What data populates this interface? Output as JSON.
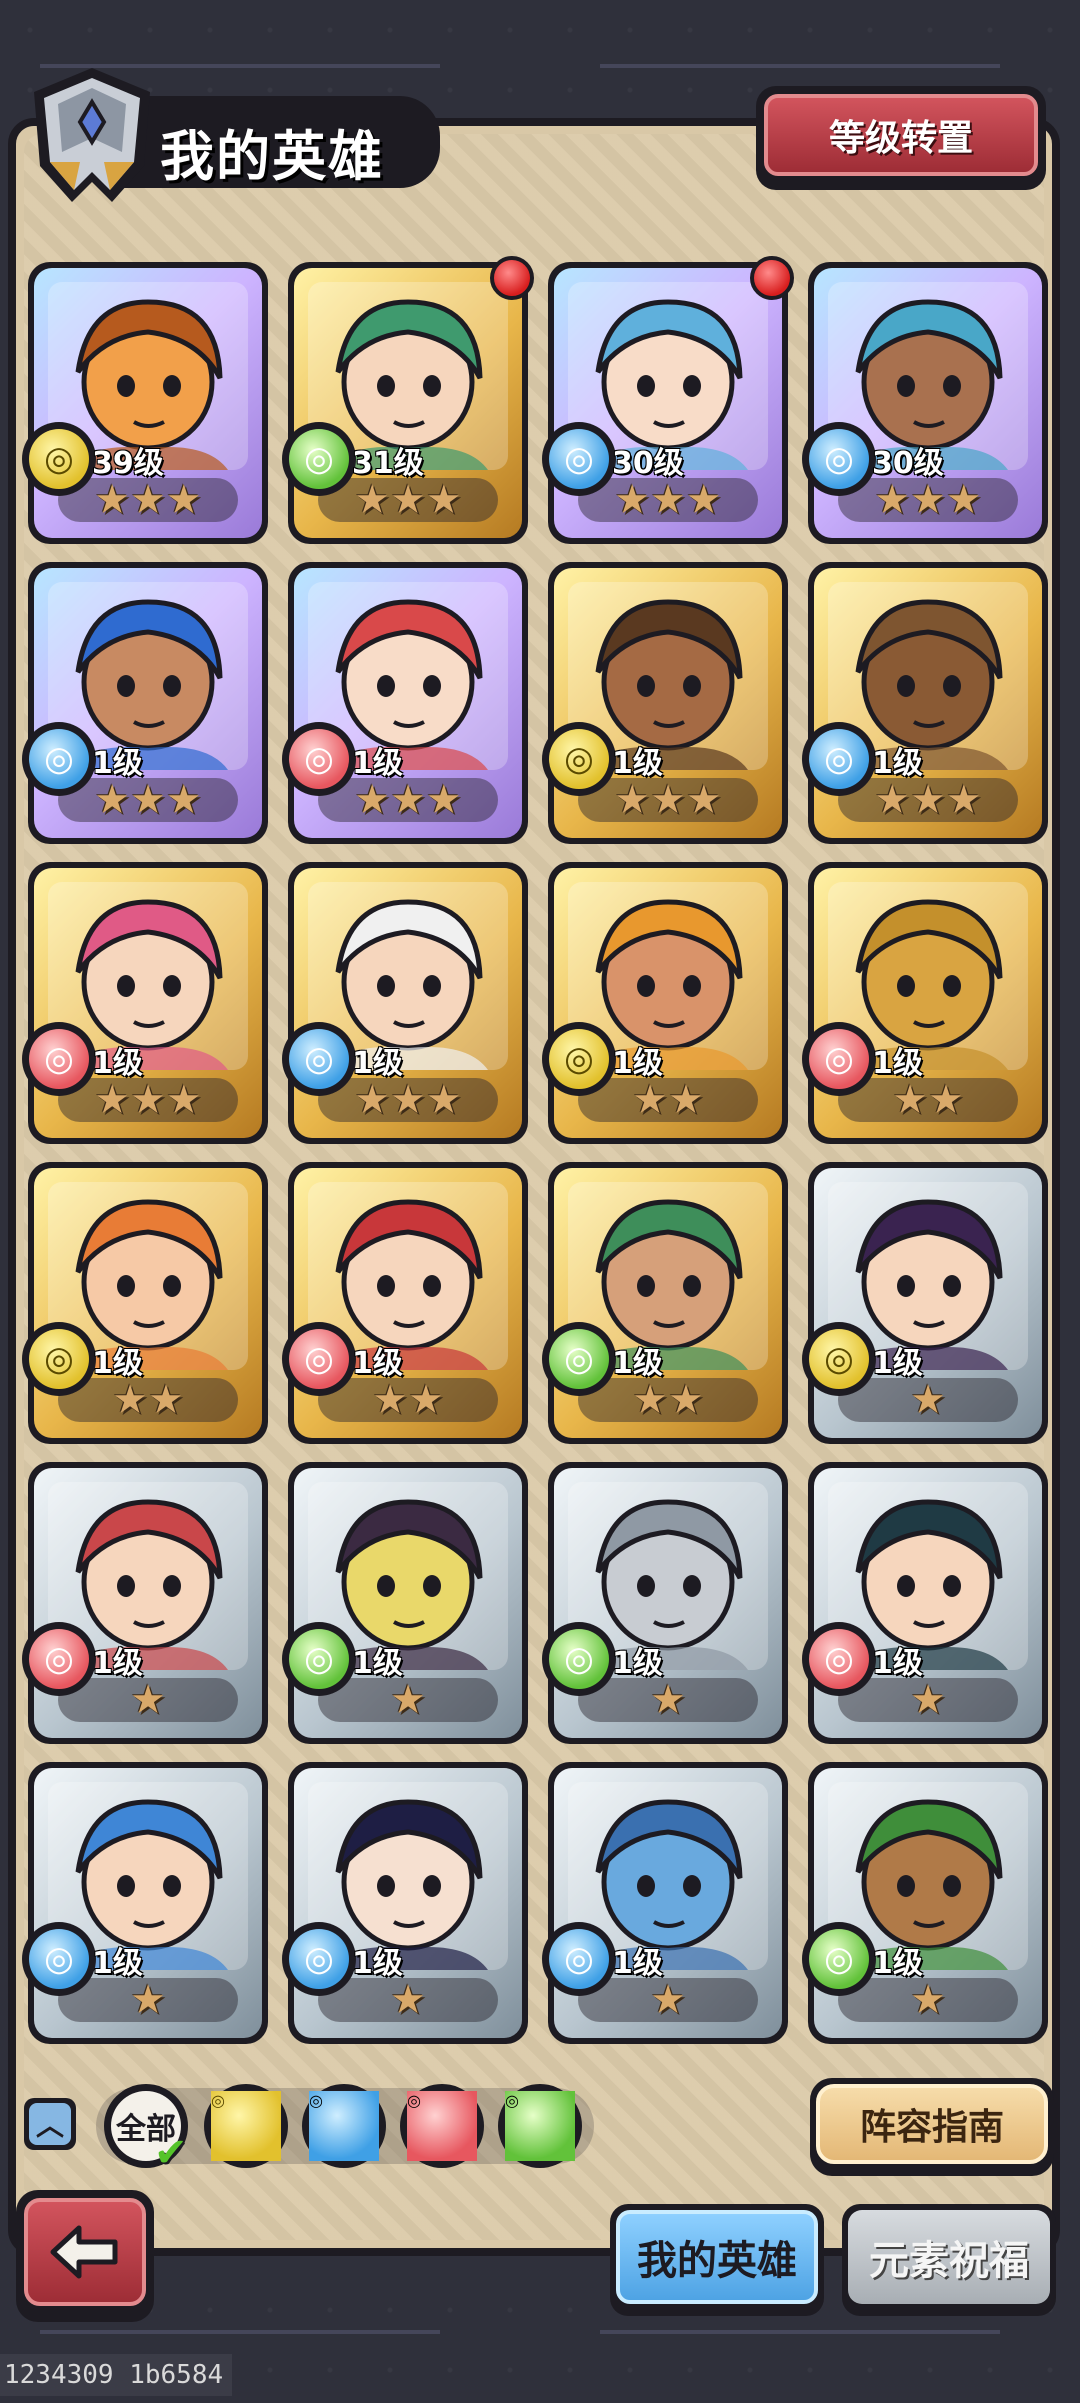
{
  "header": {
    "title": "我的英雄",
    "level_transfer_label": "等级转置"
  },
  "heroes": [
    {
      "level": "39级",
      "element": "earth",
      "stars": "★★★",
      "rarity": "purple",
      "new": false,
      "skin": "#f2a04a",
      "hair": "#b65a1e"
    },
    {
      "level": "31级",
      "element": "wind",
      "stars": "★★★",
      "rarity": "gold",
      "new": true,
      "skin": "#f6d6bd",
      "hair": "#3f9a6e"
    },
    {
      "level": "30级",
      "element": "water",
      "stars": "★★★",
      "rarity": "purple",
      "new": true,
      "skin": "#f8dcc8",
      "hair": "#5fb0dc"
    },
    {
      "level": "30级",
      "element": "water",
      "stars": "★★★",
      "rarity": "purple",
      "new": false,
      "skin": "#a9714f",
      "hair": "#49a7c8"
    },
    {
      "level": "1级",
      "element": "water",
      "stars": "★★★",
      "rarity": "purple",
      "new": false,
      "skin": "#c88a62",
      "hair": "#2f6bd0"
    },
    {
      "level": "1级",
      "element": "fire",
      "stars": "★★★",
      "rarity": "purple",
      "new": false,
      "skin": "#f8dcc8",
      "hair": "#d9494a"
    },
    {
      "level": "1级",
      "element": "earth",
      "stars": "★★★",
      "rarity": "gold",
      "new": false,
      "skin": "#a56a44",
      "hair": "#5a3920"
    },
    {
      "level": "1级",
      "element": "water",
      "stars": "★★★",
      "rarity": "gold",
      "new": false,
      "skin": "#8a5a34",
      "hair": "#7e5530"
    },
    {
      "level": "1级",
      "element": "fire",
      "stars": "★★★",
      "rarity": "gold",
      "new": false,
      "skin": "#f6d6bd",
      "hair": "#e05a86"
    },
    {
      "level": "1级",
      "element": "water",
      "stars": "★★★",
      "rarity": "gold",
      "new": false,
      "skin": "#f6d6bd",
      "hair": "#f0f0f0"
    },
    {
      "level": "1级",
      "element": "earth",
      "stars": "★★",
      "rarity": "gold",
      "new": false,
      "skin": "#d9936a",
      "hair": "#e8982e"
    },
    {
      "level": "1级",
      "element": "fire",
      "stars": "★★",
      "rarity": "gold",
      "new": false,
      "skin": "#d9a441",
      "hair": "#c4902c"
    },
    {
      "level": "1级",
      "element": "earth",
      "stars": "★★",
      "rarity": "gold",
      "new": false,
      "skin": "#f6c9a6",
      "hair": "#e87c36"
    },
    {
      "level": "1级",
      "element": "fire",
      "stars": "★★",
      "rarity": "gold",
      "new": false,
      "skin": "#f6d6bd",
      "hair": "#c8373a"
    },
    {
      "level": "1级",
      "element": "wind",
      "stars": "★★",
      "rarity": "gold",
      "new": false,
      "skin": "#d6a07a",
      "hair": "#3e8e5a"
    },
    {
      "level": "1级",
      "element": "earth",
      "stars": "★",
      "rarity": "silver",
      "new": false,
      "skin": "#f6d6bd",
      "hair": "#3a2350"
    },
    {
      "level": "1级",
      "element": "fire",
      "stars": "★",
      "rarity": "silver",
      "new": false,
      "skin": "#f6d6bd",
      "hair": "#c9474a"
    },
    {
      "level": "1级",
      "element": "wind",
      "stars": "★",
      "rarity": "silver",
      "new": false,
      "skin": "#e9d86a",
      "hair": "#3b2a42"
    },
    {
      "level": "1级",
      "element": "wind",
      "stars": "★",
      "rarity": "silver",
      "new": false,
      "skin": "#c8ccd2",
      "hair": "#8f99a4"
    },
    {
      "level": "1级",
      "element": "fire",
      "stars": "★",
      "rarity": "silver",
      "new": false,
      "skin": "#f6d6bd",
      "hair": "#1f3a44"
    },
    {
      "level": "1级",
      "element": "water",
      "stars": "★",
      "rarity": "silver",
      "new": false,
      "skin": "#f6d6bd",
      "hair": "#3f86d6"
    },
    {
      "level": "1级",
      "element": "water",
      "stars": "★",
      "rarity": "silver",
      "new": false,
      "skin": "#f6e0d0",
      "hair": "#1e1e44"
    },
    {
      "level": "1级",
      "element": "water",
      "stars": "★",
      "rarity": "silver",
      "new": false,
      "skin": "#69a9de",
      "hair": "#3a70b0"
    },
    {
      "level": "1级",
      "element": "wind",
      "stars": "★",
      "rarity": "silver",
      "new": false,
      "skin": "#b07a48",
      "hair": "#3f8e3a"
    }
  ],
  "filters": {
    "all_label": "全部",
    "elements": [
      "earth",
      "water",
      "fire",
      "wind"
    ]
  },
  "guide_label": "阵容指南",
  "tabs": {
    "my_heroes": "我的英雄",
    "element_blessing": "元素祝福"
  },
  "footer_code": "1234309 1b6584",
  "icons": {
    "back": "back-arrow-icon",
    "toggle": "chevron-up-icon",
    "header": "helmet-icon"
  },
  "colors": {
    "earth": "#e2c12d",
    "water": "#3fa0e6",
    "fire": "#e7575f",
    "wind": "#62c23a"
  }
}
